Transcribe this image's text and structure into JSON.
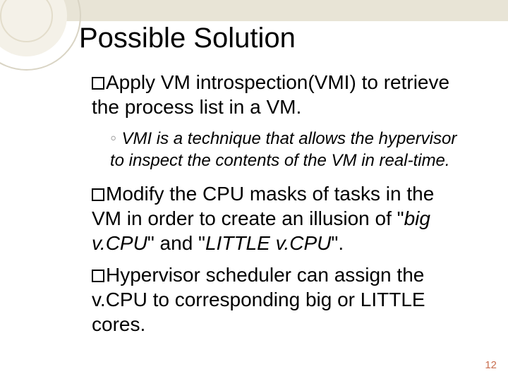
{
  "title": "Possible Solution",
  "bullets": {
    "b1": {
      "run1": "Apply VM introspection(VMI) to retrieve the process list in a VM.",
      "sub": {
        "run1": "VMI is a technique that allows the hypervisor to inspect the contents of the VM in real-time."
      }
    },
    "b2": {
      "run1": "Modify the CPU masks of tasks in the VM in order to create an illusion of \"",
      "emph1": "big v.CPU",
      "run2": "\" and \"",
      "emph2": "LITTLE v.CPU",
      "run3": "\"."
    },
    "b3": {
      "run1": "Hypervisor scheduler can assign the v.CPU to corresponding big or LITTLE cores."
    }
  },
  "page_number": "12"
}
